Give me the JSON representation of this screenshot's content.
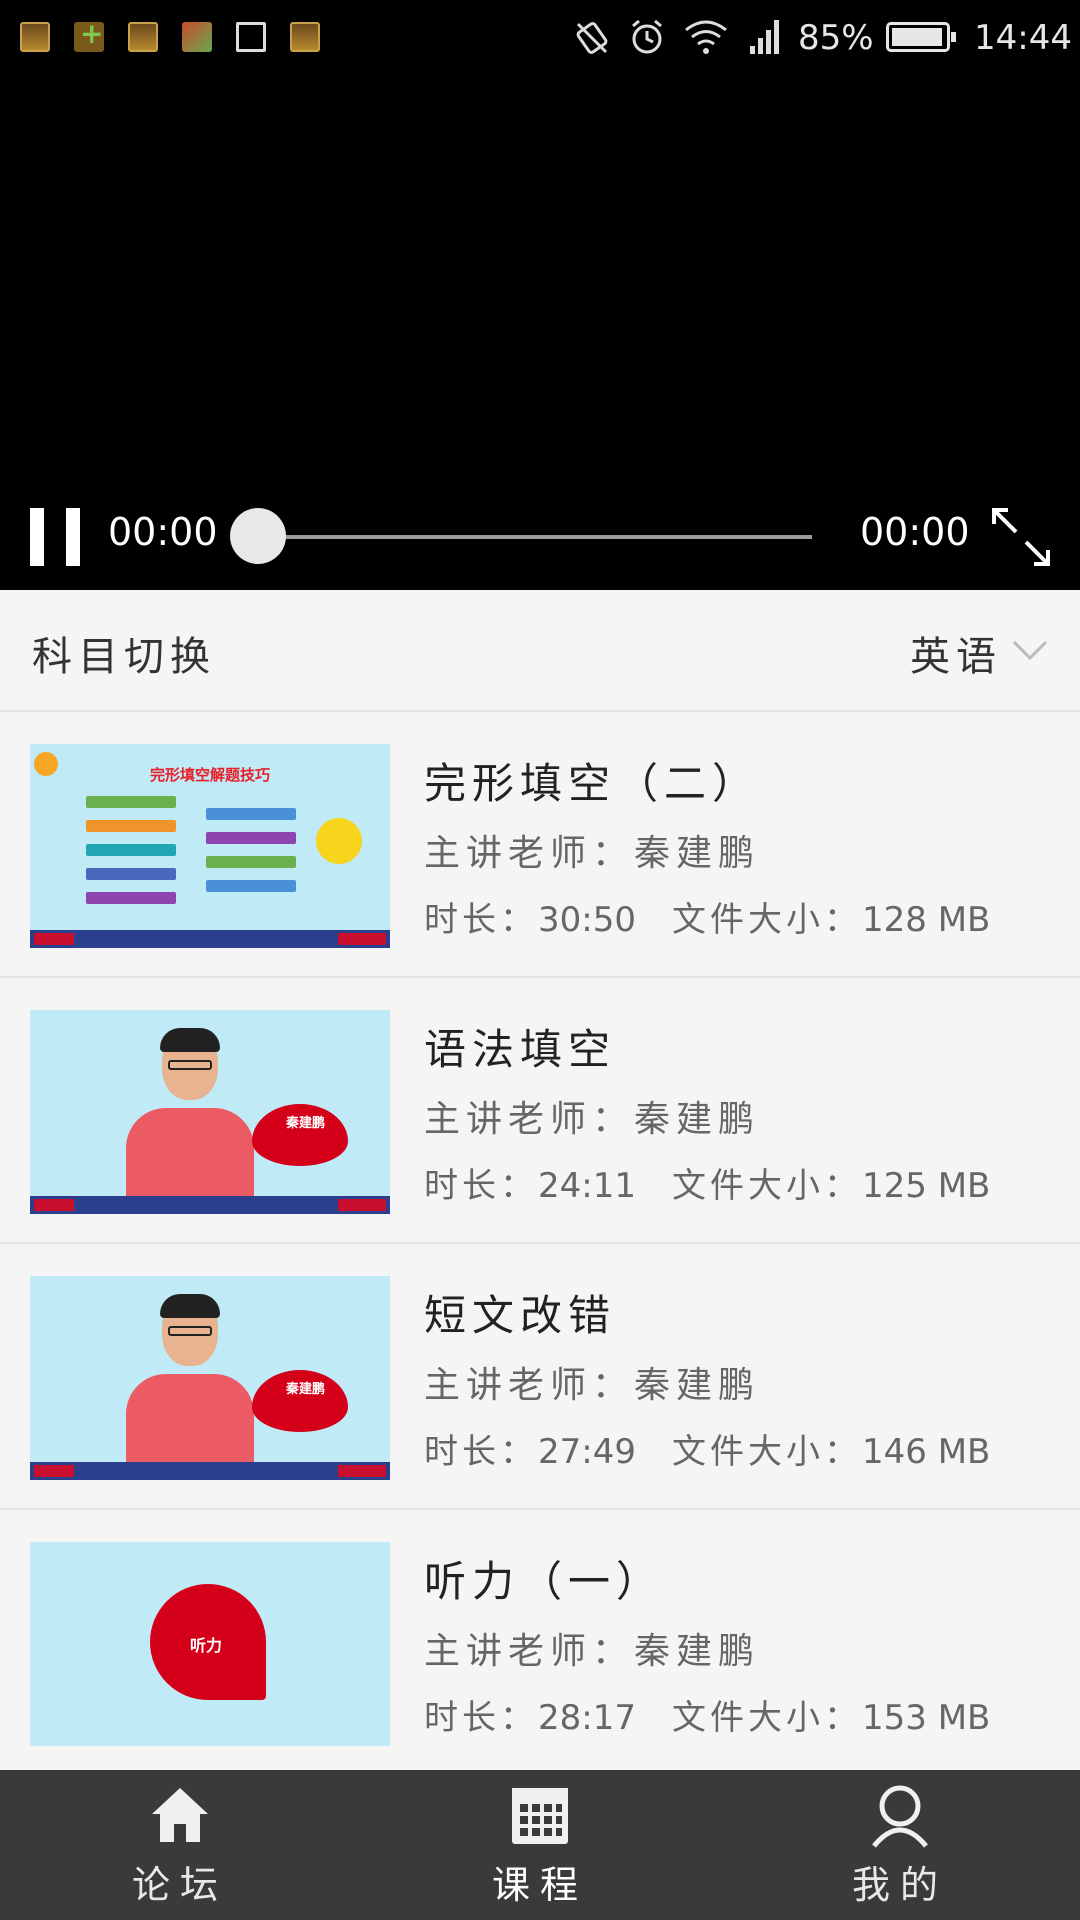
{
  "status_bar": {
    "battery_percent": "85%",
    "clock": "14:44"
  },
  "player": {
    "current_time": "00:00",
    "total_time": "00:00",
    "progress": 0
  },
  "subject": {
    "label": "科目切换",
    "selected": "英语"
  },
  "courses": [
    {
      "title": "完形填空（二）",
      "teacher": "主讲老师：秦建鹏",
      "duration_label": "时长：",
      "duration": "30:50",
      "size_label": "文件大小：",
      "size": "128 MB",
      "thumb": {
        "heading": "完形填空解题技巧"
      }
    },
    {
      "title": "语法填空",
      "teacher": "主讲老师：秦建鹏",
      "duration_label": "时长：",
      "duration": "24:11",
      "size_label": "文件大小：",
      "size": "125 MB",
      "thumb": {
        "name": "秦建鹏"
      }
    },
    {
      "title": "短文改错",
      "teacher": "主讲老师：秦建鹏",
      "duration_label": "时长：",
      "duration": "27:49",
      "size_label": "文件大小：",
      "size": "146 MB",
      "thumb": {
        "name": "秦建鹏"
      }
    },
    {
      "title": "听力（一）",
      "teacher": "主讲老师：秦建鹏",
      "duration_label": "时长：",
      "duration": "28:17",
      "size_label": "文件大小：",
      "size": "153 MB",
      "thumb": {
        "badge": "听力"
      }
    }
  ],
  "nav": {
    "items": [
      {
        "label": "论坛",
        "icon": "home-icon"
      },
      {
        "label": "课程",
        "icon": "calendar-icon"
      },
      {
        "label": "我的",
        "icon": "user-icon"
      }
    ]
  },
  "colors": {
    "video_bg": "#000000",
    "page_bg": "#f5f5f5",
    "nav_bg": "#3a3a3a",
    "thumb_bg": "#bfeaf6",
    "brand_red": "#d4001a"
  }
}
